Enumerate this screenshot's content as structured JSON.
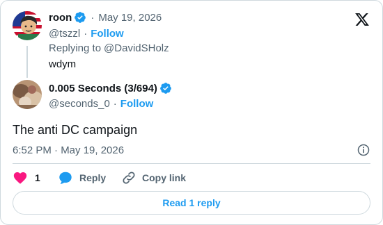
{
  "parent": {
    "name": "roon",
    "date": "May 19, 2026",
    "handle": "@tszzl",
    "follow_label": "Follow",
    "replying_prefix": "Replying to ",
    "replying_to": "@DavidSHolz",
    "text": "wdym"
  },
  "reply": {
    "name": "0.005 Seconds (3/694)",
    "handle": "@seconds_0",
    "follow_label": "Follow",
    "text": "The anti DC campaign",
    "timestamp": "6:52 PM · May 19, 2026"
  },
  "actions": {
    "like_count": "1",
    "reply_label": "Reply",
    "copy_link_label": "Copy link"
  },
  "read_replies_label": "Read 1 reply",
  "colors": {
    "accent": "#1d9bf0",
    "like": "#f91880",
    "text": "#0f1419",
    "muted": "#536471",
    "border": "#cfd9de"
  }
}
